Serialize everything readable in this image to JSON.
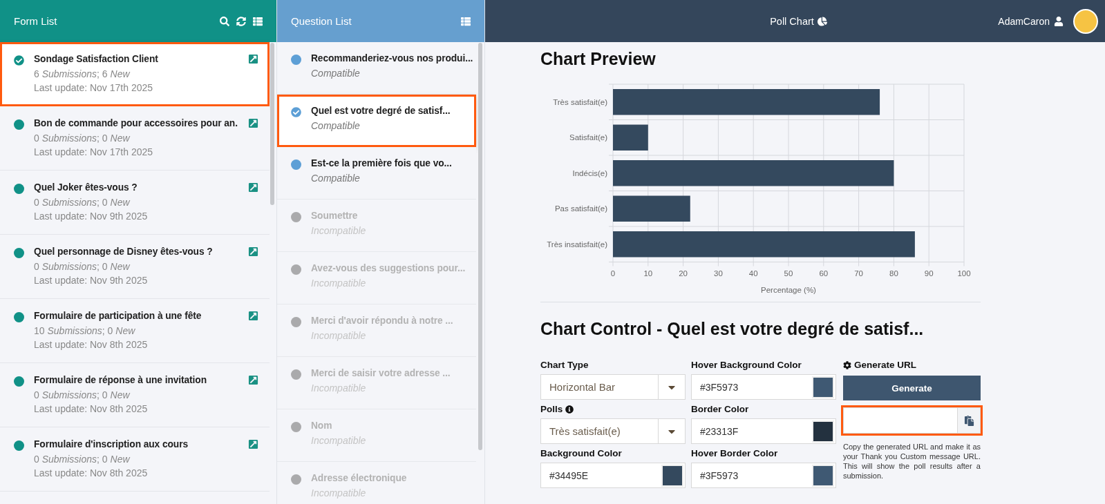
{
  "form_list": {
    "title": "Form List",
    "items": [
      {
        "title": "Sondage Satisfaction Client",
        "stats": "6 *Submissions*; 6 *New*",
        "updated": "Last update: Nov 17th 2025",
        "selected": true
      },
      {
        "title": "Bon de commande pour accessoires pour an.",
        "stats": "0 *Submissions*; 0 *New*",
        "updated": "Last update: Nov 17th 2025",
        "selected": false
      },
      {
        "title": "Quel Joker êtes-vous ?",
        "stats": "0 *Submissions*; 0 *New*",
        "updated": "Last update: Nov 9th 2025",
        "selected": false
      },
      {
        "title": "Quel personnage de Disney êtes-vous ?",
        "stats": "0 *Submissions*; 0 *New*",
        "updated": "Last update: Nov 9th 2025",
        "selected": false
      },
      {
        "title": "Formulaire de participation à une fête",
        "stats": "10 *Submissions*; 0 *New*",
        "updated": "Last update: Nov 8th 2025",
        "selected": false
      },
      {
        "title": "Formulaire de réponse à une invitation",
        "stats": "0 *Submissions*; 0 *New*",
        "updated": "Last update: Nov 8th 2025",
        "selected": false
      },
      {
        "title": "Formulaire d'inscription aux cours",
        "stats": "0 *Submissions*; 0 *New*",
        "updated": "Last update: Nov 8th 2025",
        "selected": false
      }
    ]
  },
  "question_list": {
    "title": "Question List",
    "items": [
      {
        "title": "Recommanderiez-vous nos produi...",
        "status": "Compatible",
        "compatible": true,
        "selected": false
      },
      {
        "title": "Quel est votre degré de satisf...",
        "status": "Compatible",
        "compatible": true,
        "selected": true
      },
      {
        "title": "Est-ce la première fois que vo...",
        "status": "Compatible",
        "compatible": true,
        "selected": false
      },
      {
        "title": "Soumettre",
        "status": "Incompatible",
        "compatible": false,
        "selected": false
      },
      {
        "title": "Avez-vous des suggestions pour...",
        "status": "Incompatible",
        "compatible": false,
        "selected": false
      },
      {
        "title": "Merci d'avoir répondu à notre ...",
        "status": "Incompatible",
        "compatible": false,
        "selected": false
      },
      {
        "title": "Merci de saisir votre adresse ...",
        "status": "Incompatible",
        "compatible": false,
        "selected": false
      },
      {
        "title": "Nom",
        "status": "Incompatible",
        "compatible": false,
        "selected": false
      },
      {
        "title": "Adresse électronique",
        "status": "Incompatible",
        "compatible": false,
        "selected": false
      }
    ]
  },
  "header": {
    "title": "Poll Chart",
    "user": "AdamCaron"
  },
  "preview": {
    "title": "Chart Preview",
    "chart_data": {
      "type": "bar",
      "orientation": "horizontal",
      "xlabel": "Percentage (%)",
      "categories": [
        "Très satisfait(e)",
        "Satisfait(e)",
        "Indécis(e)",
        "Pas satisfait(e)",
        "Très insatisfait(e)"
      ],
      "series": [
        {
          "color": "#34495e",
          "values": [
            76,
            10,
            80,
            22,
            86
          ]
        }
      ],
      "grid": true,
      "xlim": [
        0,
        100
      ],
      "xticks": [
        0,
        10,
        20,
        30,
        40,
        50,
        60,
        70,
        80,
        90,
        100
      ]
    }
  },
  "control": {
    "title": "Chart Control - Quel est votre degré de satisf...",
    "fields": [
      {
        "kind": "select",
        "label": "Chart Type",
        "value": "Horizontal Bar"
      },
      {
        "kind": "color",
        "label": "Hover Background Color",
        "value": "#3F5973",
        "color": "#3f5973"
      },
      {
        "kind": "select",
        "label": "Polls",
        "value": "Très satisfait(e)",
        "info": true
      },
      {
        "kind": "color",
        "label": "Border Color",
        "value": "#23313F",
        "color": "#23313f"
      },
      {
        "kind": "color",
        "label": "Background Color",
        "value": "#34495E",
        "color": "#34495e"
      },
      {
        "kind": "color",
        "label": "Hover Border Color",
        "value": "#3F5973",
        "color": "#3f5973"
      }
    ],
    "generate": {
      "label": "Generate URL",
      "button": "Generate",
      "url_highlighted": true,
      "note": "Copy the generated URL and make it as your Thank you Custom message URL. This will show the poll results after a submission."
    }
  }
}
